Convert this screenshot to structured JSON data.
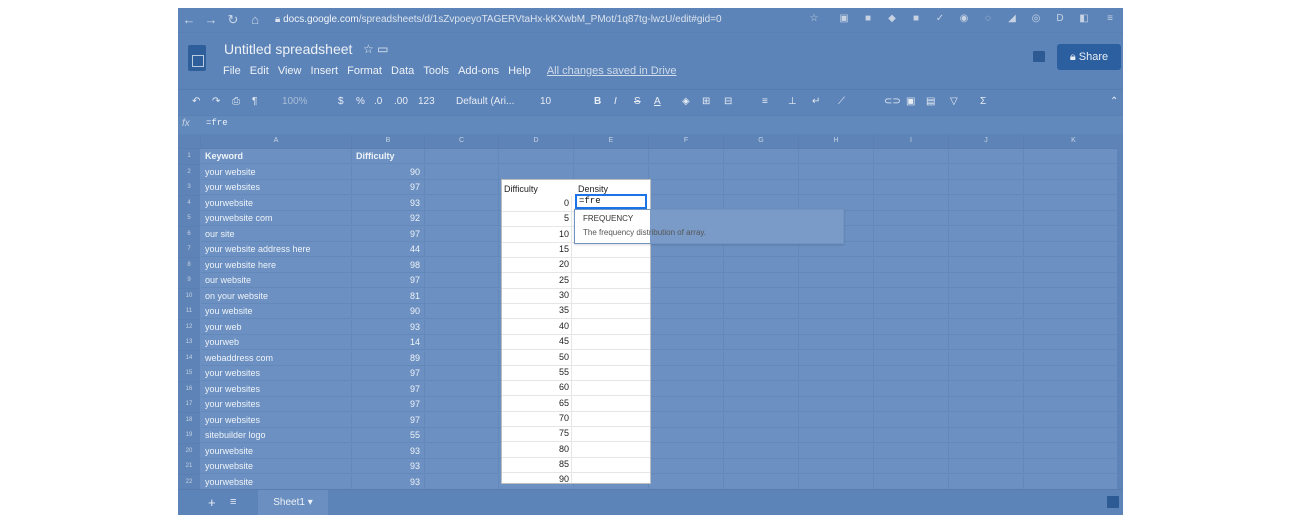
{
  "browser": {
    "url_host": "docs.google.com",
    "url_path": "/spreadsheets/d/1sZvpoeyoTAGERVtaHx-kKXwbM_PMot/1q87tg-lwzU/edit#gid=0",
    "back_icon": "back-arrow-icon",
    "forward_icon": "forward-arrow-icon",
    "reload_icon": "reload-icon",
    "home_icon": "home-icon"
  },
  "doc": {
    "title": "Untitled spreadsheet",
    "menus": [
      "File",
      "Edit",
      "View",
      "Insert",
      "Format",
      "Data",
      "Tools",
      "Add-ons",
      "Help"
    ],
    "saved_status": "All changes saved in Drive",
    "share_label": "Share"
  },
  "toolbar": {
    "zoom": "100%",
    "currency": "$",
    "percent": "%",
    "dec_less": ".0",
    "dec_more": ".00",
    "format_more": "123",
    "font": "Default (Ari...",
    "font_size": "10",
    "bold": "B",
    "italic": "I",
    "strike": "S",
    "text_color": "A"
  },
  "formula": {
    "fx_label": "fx",
    "value": "=fre"
  },
  "columns": [
    "A",
    "B",
    "C",
    "D",
    "E",
    "F",
    "G",
    "H",
    "I",
    "J",
    "K"
  ],
  "rows": [
    {
      "n": "1",
      "a": "Keyword",
      "b": "Difficulty"
    },
    {
      "n": "2",
      "a": "your website",
      "b": "90"
    },
    {
      "n": "3",
      "a": "your websites",
      "b": "97"
    },
    {
      "n": "4",
      "a": "yourwebsite",
      "b": "93"
    },
    {
      "n": "5",
      "a": "yourwebsite com",
      "b": "92"
    },
    {
      "n": "6",
      "a": "our site",
      "b": "97"
    },
    {
      "n": "7",
      "a": "your website address here",
      "b": "44"
    },
    {
      "n": "8",
      "a": "your website here",
      "b": "98"
    },
    {
      "n": "9",
      "a": "our website",
      "b": "97"
    },
    {
      "n": "10",
      "a": "on your website",
      "b": "81"
    },
    {
      "n": "11",
      "a": "you website",
      "b": "90"
    },
    {
      "n": "12",
      "a": "your web",
      "b": "93"
    },
    {
      "n": "13",
      "a": "yourweb",
      "b": "14"
    },
    {
      "n": "14",
      "a": "webaddress com",
      "b": "89"
    },
    {
      "n": "15",
      "a": "your websites",
      "b": "97"
    },
    {
      "n": "16",
      "a": "your websites",
      "b": "97"
    },
    {
      "n": "17",
      "a": "your websites",
      "b": "97"
    },
    {
      "n": "18",
      "a": "your websites",
      "b": "97"
    },
    {
      "n": "19",
      "a": "sitebuilder logo",
      "b": "55"
    },
    {
      "n": "20",
      "a": "yourwebsite",
      "b": "93"
    },
    {
      "n": "21",
      "a": "yourwebsite",
      "b": "93"
    },
    {
      "n": "22",
      "a": "yourwebsite",
      "b": "93"
    }
  ],
  "popup": {
    "header_difficulty": "Difficulty",
    "header_density": "Density",
    "values": [
      "0",
      "5",
      "10",
      "15",
      "20",
      "25",
      "30",
      "35",
      "40",
      "45",
      "50",
      "55",
      "60",
      "65",
      "70",
      "75",
      "80",
      "85",
      "90"
    ],
    "active_input": "=fre"
  },
  "suggestion": {
    "name": "FREQUENCY",
    "description": "The frequency distribution of array."
  },
  "sheets": {
    "add_icon": "+",
    "menu_icon": "≡",
    "tab_label": "Sheet1"
  }
}
